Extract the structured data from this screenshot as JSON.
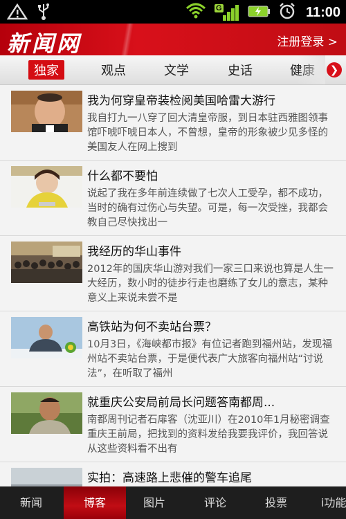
{
  "status_bar": {
    "time": "11:00",
    "network_badge": "G"
  },
  "header": {
    "logo": "新闻网",
    "login_label": "注册登录 >"
  },
  "tabs": [
    {
      "label": "独家",
      "active": true
    },
    {
      "label": "观点"
    },
    {
      "label": "文学"
    },
    {
      "label": "史话"
    },
    {
      "label": "健康"
    }
  ],
  "articles": [
    {
      "title": "我为何穿皇帝装检阅美国哈雷大游行",
      "summary": "我自打九一八穿了回大清皇帝服，到日本驻西雅图领事馆吓唬吓唬日本人，不曾想，皇帝的形象被少见多怪的美国友人在网上搜到"
    },
    {
      "title": "什么都不要怕",
      "summary": "说起了我在多年前连续做了七次人工受孕，都不成功，当时的确有过伤心与失望。可是，每一次受挫，我都会教自己尽快找出一"
    },
    {
      "title": "我经历的华山事件",
      "summary": "2012年的国庆华山游对我们一家三口来说也算是人生一大经历，数小时的徒步行走也磨练了女儿的意志，某种意义上来说未尝不是"
    },
    {
      "title": "高铁站为何不卖站台票？",
      "summary": "10月3日，《海峡都市报》有位记者跑到福州站，发现福州站不卖站台票，于是便代表广大旅客向福州站“讨说法”，在听取了福州"
    },
    {
      "title": "就重庆公安局前局长问题答南都周...",
      "summary": "南都周刊记者石扉客（沈亚川）在2010年1月秘密调查重庆王前局，把找到的资料发给我要我评价，我回答说从这些资料看不出有"
    },
    {
      "title": "实拍：高速路上悲催的警车追尾",
      "summary": ""
    }
  ],
  "bottom_nav": [
    {
      "label": "新闻"
    },
    {
      "label": "博客",
      "active": true
    },
    {
      "label": "图片"
    },
    {
      "label": "评论"
    },
    {
      "label": "投票"
    },
    {
      "label": "i功能"
    }
  ],
  "colors": {
    "brand_red": "#d40c12",
    "status_green": "#8bd12b"
  },
  "icons": [
    "warning-icon",
    "usb-icon",
    "wifi-icon",
    "signal-icon",
    "battery-icon",
    "alarm-clock-icon",
    "chevron-right-icon"
  ]
}
